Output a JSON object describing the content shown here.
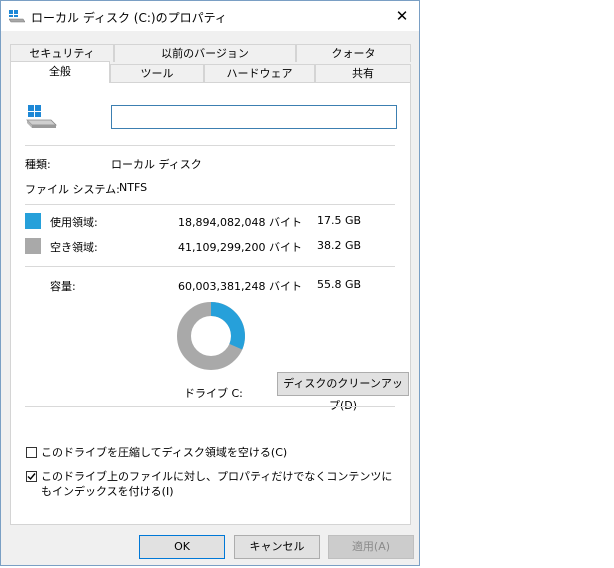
{
  "window": {
    "title": "ローカル ディスク (C:)のプロパティ",
    "close_glyph": "✕"
  },
  "tabs_row1": [
    "セキュリティ",
    "以前のバージョン",
    "クォータ"
  ],
  "tabs_row2": [
    "全般",
    "ツール",
    "ハードウェア",
    "共有"
  ],
  "general": {
    "drive_label_value": "",
    "type_label": "種類:",
    "type_value": "ローカル ディスク",
    "fs_label": "ファイル システム:",
    "fs_value": "NTFS",
    "used_label": "使用領域:",
    "used_bytes": "18,894,082,048 バイト",
    "used_gb": "17.5 GB",
    "free_label": "空き領域:",
    "free_bytes": "41,109,299,200 バイト",
    "free_gb": "38.2 GB",
    "capacity_label": "容量:",
    "capacity_bytes": "60,003,381,248 バイト",
    "capacity_gb": "55.8 GB",
    "drive_caption": "ドライブ C:",
    "cleanup_button": "ディスクのクリーンアップ(D)",
    "compress_label": "このドライブを圧縮してディスク領域を空ける(C)",
    "compress_checked": false,
    "index_label": "このドライブ上のファイルに対し、プロパティだけでなくコンテンツにもインデックスを付ける(I)",
    "index_checked": true
  },
  "buttons": {
    "ok": "OK",
    "cancel": "キャンセル",
    "apply": "適用(A)"
  },
  "colors": {
    "used": "#26a0da",
    "free": "#a9a9a9",
    "focus_border": "#0078d7"
  },
  "chart_data": {
    "type": "pie",
    "categories": [
      "使用領域",
      "空き領域"
    ],
    "values": [
      18894082048,
      41109299200
    ]
  }
}
